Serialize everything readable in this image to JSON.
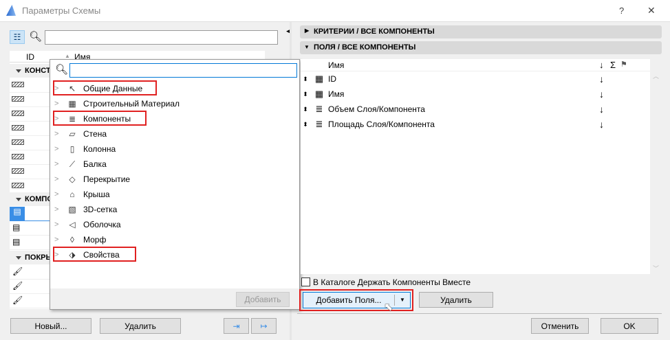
{
  "window": {
    "title": "Параметры Схемы",
    "help": "?",
    "close": "✕"
  },
  "left": {
    "search_value": "",
    "columns": {
      "id": "ID",
      "name": "Имя"
    },
    "groups": [
      {
        "label": "КОНСТ"
      },
      {
        "label": "КОМПО"
      },
      {
        "label": "ПОКРЫ"
      }
    ],
    "buttons": {
      "new": "Новый...",
      "delete": "Удалить"
    }
  },
  "popup": {
    "search_value": "",
    "items": [
      {
        "label": "Общие Данные",
        "icon": "↖",
        "highlighted": true
      },
      {
        "label": "Строительный Материал",
        "icon": "▦",
        "highlighted": false
      },
      {
        "label": "Компоненты",
        "icon": "≣",
        "highlighted": true
      },
      {
        "label": "Стена",
        "icon": "▱",
        "highlighted": false
      },
      {
        "label": "Колонна",
        "icon": "▯",
        "highlighted": false
      },
      {
        "label": "Балка",
        "icon": "⟋",
        "highlighted": false
      },
      {
        "label": "Перекрытие",
        "icon": "◇",
        "highlighted": false
      },
      {
        "label": "Крыша",
        "icon": "⌂",
        "highlighted": false
      },
      {
        "label": "3D-сетка",
        "icon": "▧",
        "highlighted": false
      },
      {
        "label": "Оболочка",
        "icon": "◁",
        "highlighted": false
      },
      {
        "label": "Морф",
        "icon": "◊",
        "highlighted": false
      },
      {
        "label": "Свойства",
        "icon": "⬗",
        "highlighted": true
      }
    ],
    "add_button": "Добавить"
  },
  "right": {
    "criteria_header": "КРИТЕРИИ /  ВСЕ КОМПОНЕНТЫ",
    "fields_header": "ПОЛЯ /  ВСЕ КОМПОНЕНТЫ",
    "columns": {
      "name": "Имя",
      "sort": "↓",
      "sum": "Σ",
      "flag": "⚑"
    },
    "fields": [
      {
        "name": "ID",
        "icon": "▦",
        "sort": "↓"
      },
      {
        "name": "Имя",
        "icon": "▦",
        "sort": "↓"
      },
      {
        "name": "Объем Слоя/Компонента",
        "icon": "≣",
        "sort": "↓"
      },
      {
        "name": "Площадь Слоя/Компонента",
        "icon": "≣",
        "sort": "↓"
      }
    ],
    "keep_together_label": "В Каталоге Держать Компоненты Вместе",
    "keep_together_checked": false,
    "add_fields": "Добавить Поля...",
    "delete": "Удалить"
  },
  "footer": {
    "cancel": "Отменить",
    "ok": "OK"
  },
  "colors": {
    "highlight": "#e02020",
    "accent": "#0078d7"
  }
}
